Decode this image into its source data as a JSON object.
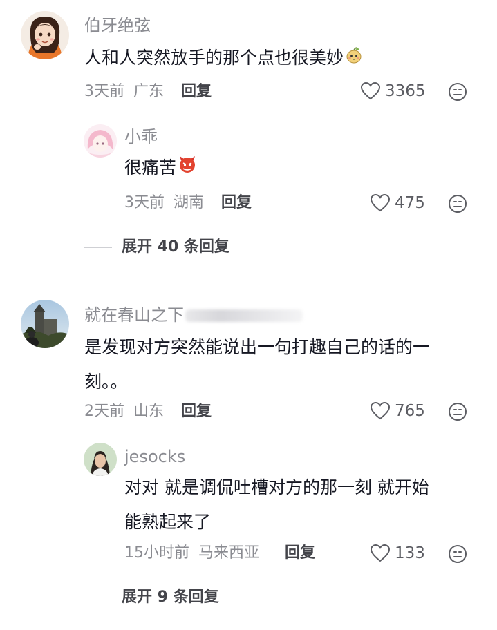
{
  "comments": [
    {
      "username": "伯牙绝弦",
      "text": "人和人突然放手的那个点也很美妙",
      "time": "3天前",
      "location": "广东",
      "reply_label": "回复",
      "likes": "3365",
      "replies": [
        {
          "username": "小乖",
          "text": "很痛苦",
          "time": "3天前",
          "location": "湖南",
          "reply_label": "回复",
          "likes": "475"
        }
      ],
      "expand_label": "展开 40 条回复"
    },
    {
      "username": "就在春山之下",
      "text_line1": "是发现对方突然能说出一句打趣自己的话的一",
      "text_line2": "刻。。",
      "time": "2天前",
      "location": "山东",
      "reply_label": "回复",
      "likes": "765",
      "replies": [
        {
          "username": "jesocks",
          "text_line1": "对对 就是调侃吐槽对方的那一刻 就开始",
          "text_line2": "能熟起来了",
          "time": "15小时前",
          "location": "马来西亚",
          "reply_label": "回复",
          "likes": "133"
        }
      ],
      "expand_label": "展开 9 条回复"
    }
  ],
  "icons": {
    "like": "heart-outline-icon",
    "dislike": "neutral-face-icon"
  },
  "colors": {
    "text_primary": "#161823",
    "text_secondary": "#8a8b91",
    "icon": "#5c5d63"
  }
}
